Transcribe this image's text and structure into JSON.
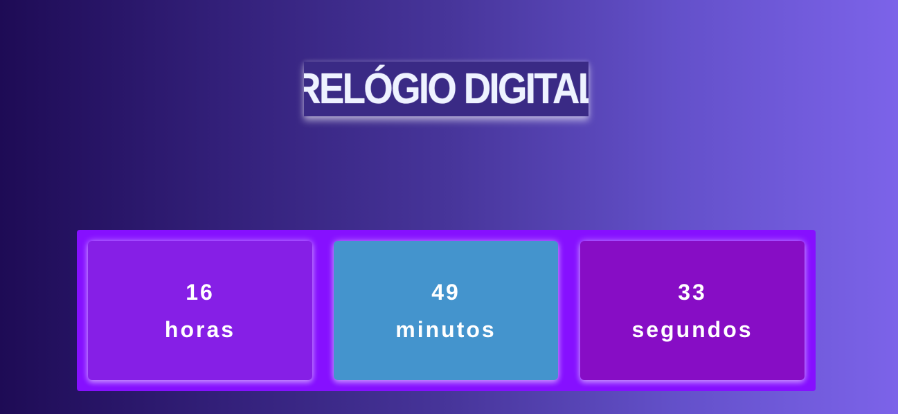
{
  "title": "RELÓGIO DIGITAL",
  "clock": {
    "hours": {
      "value": "16",
      "label": "horas"
    },
    "minutes": {
      "value": "49",
      "label": "minutos"
    },
    "seconds": {
      "value": "33",
      "label": "segundos"
    }
  },
  "colors": {
    "container": "#8610ff",
    "hours_box": "#861fe6",
    "minutes_box": "#4494cd",
    "seconds_box": "#870dc5",
    "text": "#ffffff",
    "title_text": "#eef2ff"
  }
}
